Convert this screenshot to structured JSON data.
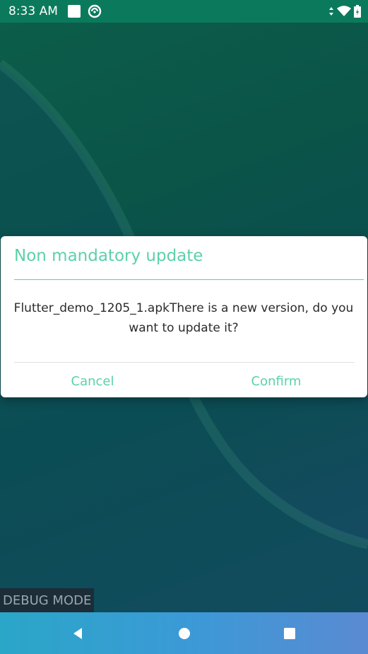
{
  "status_bar": {
    "time": "8:33 AM",
    "left_icons": [
      "square-notification-icon",
      "circle-sync-icon"
    ],
    "right_icons": [
      "data-arrows-icon",
      "wifi-icon",
      "battery-icon"
    ]
  },
  "dialog": {
    "title": "Non mandatory update",
    "message": "Flutter_demo_1205_1.apkThere is a new version, do you want to update it?",
    "cancel_label": "Cancel",
    "confirm_label": "Confirm"
  },
  "debug_label": "DEBUG MODE",
  "nav_bar": {
    "buttons": [
      "back-icon",
      "home-icon",
      "recents-icon"
    ]
  },
  "colors": {
    "accent": "#5cd0ac",
    "status_bar": "#0b7a5c",
    "dialog_bg": "#ffffff",
    "message_text": "#2b2b2b"
  }
}
